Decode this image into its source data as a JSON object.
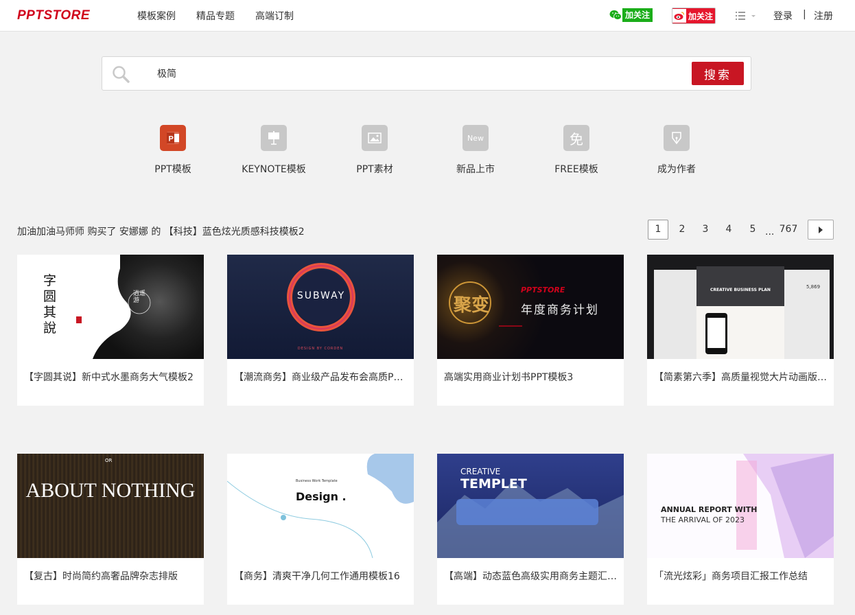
{
  "header": {
    "logo": "PPTSTORE",
    "nav": [
      "模板案例",
      "精品专题",
      "高端订制"
    ],
    "wechat_label": "加关注",
    "weibo_label": "加关注",
    "login": "登录",
    "divider": "|",
    "register": "注册"
  },
  "search": {
    "value": "极简",
    "button_label": "搜索"
  },
  "categories": [
    {
      "label": "PPT模板",
      "icon_text": "P"
    },
    {
      "label": "KEYNOTE模板",
      "icon_text": ""
    },
    {
      "label": "PPT素材",
      "icon_text": ""
    },
    {
      "label": "新品上市",
      "icon_text": "New"
    },
    {
      "label": "FREE模板",
      "icon_text": "免"
    },
    {
      "label": "成为作者",
      "icon_text": ""
    }
  ],
  "ticker": "加油加油马师师 购买了 安娜娜 的 【科技】蓝色炫光质感科技模板2",
  "pagination": {
    "pages": [
      "1",
      "2",
      "3",
      "4",
      "5"
    ],
    "ellipsis": "...",
    "last": "767",
    "current": "1"
  },
  "cards": [
    {
      "title": "【字圆其说】新中式水墨商务大气模板2",
      "thumb_text": "字圆其說",
      "thumb_sub": "逍遥游"
    },
    {
      "title": "【潮流商务】商业级产品发布会高质PPT模板",
      "thumb_text": "SUBWAY",
      "thumb_sub": "DESIGN BY CORDEN"
    },
    {
      "title": "高端实用商业计划书PPT模板3",
      "thumb_text": "聚变",
      "thumb_sub": "年度商务计划"
    },
    {
      "title": "【简素第六季】高质量视觉大片动画版PPT模板",
      "thumb_text": "CREATIVE BUSINESS PLAN",
      "thumb_sub": "5,869"
    },
    {
      "title": "【复古】时尚简约高奢品牌杂志排版",
      "thumb_text": "ABOUT NOTHING",
      "thumb_sub": "OR"
    },
    {
      "title": "【商务】清爽干净几何工作通用模板16",
      "thumb_text": "Design .",
      "thumb_sub": "Business Work Template"
    },
    {
      "title": "【高端】动态蓝色高级实用商务主题汇报模板",
      "thumb_text": "TEMPLET",
      "thumb_sub": "CREATIVE"
    },
    {
      "title": "「流光炫彩」商务项目汇报工作总结",
      "thumb_text": "ANNUAL REPORT WITH",
      "thumb_sub": "THE ARRIVAL OF 2023"
    }
  ]
}
